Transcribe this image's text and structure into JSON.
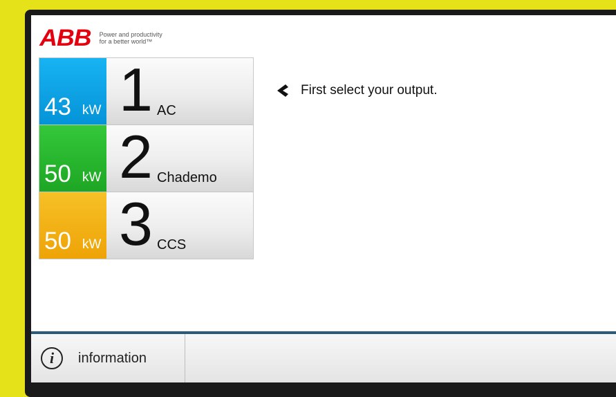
{
  "brand": {
    "logo": "ABB",
    "tagline_1": "Power and productivity",
    "tagline_2": "for a better world™"
  },
  "outputs": [
    {
      "power_value": "43",
      "power_unit": "kW",
      "number": "1",
      "type": "AC",
      "color": "#0ea6e8"
    },
    {
      "power_value": "50",
      "power_unit": "kW",
      "number": "2",
      "type": "Chademo",
      "color": "#2bb82f"
    },
    {
      "power_value": "50",
      "power_unit": "kW",
      "number": "3",
      "type": "CCS",
      "color": "#f2b317"
    }
  ],
  "prompt": {
    "icon": "chevron-left-icon",
    "text": "First select your output."
  },
  "footer": {
    "info_icon": "info-icon",
    "info_label": "information"
  }
}
